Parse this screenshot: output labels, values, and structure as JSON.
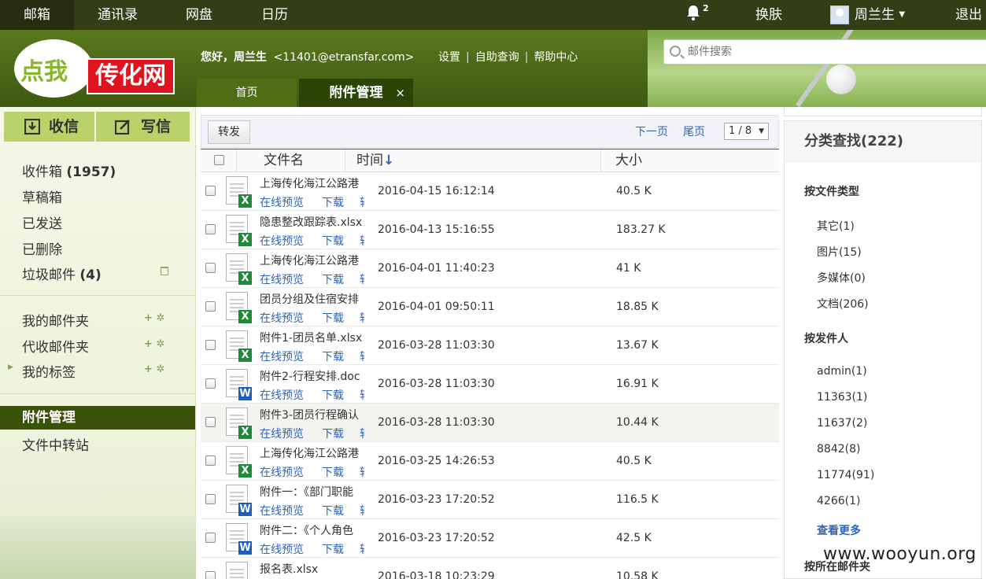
{
  "topnav": {
    "items": [
      "邮箱",
      "通讯录",
      "网盘",
      "日历"
    ],
    "notification_count": "2",
    "skin": "换肤",
    "user": "周兰生",
    "logout": "退出"
  },
  "logo": {
    "part1": "点我",
    "part2": "传化网"
  },
  "header": {
    "greeting_prefix": "您好，",
    "user_name": "周兰生",
    "email": "<11401@etransfar.com>",
    "links": [
      "设置",
      "自助查询",
      "帮助中心"
    ],
    "search_placeholder": "邮件搜索"
  },
  "tabs": {
    "home": "首页",
    "active": "附件管理",
    "close": "×"
  },
  "sidebar": {
    "inbox_button": "收信",
    "write_button": "写信",
    "folders": [
      {
        "label": "收件箱",
        "count": "(1957)"
      },
      {
        "label": "草稿箱",
        "count": ""
      },
      {
        "label": "已发送",
        "count": ""
      },
      {
        "label": "已删除",
        "count": ""
      },
      {
        "label": "垃圾邮件",
        "count": "(4)"
      }
    ],
    "groups": [
      "我的邮件夹",
      "代收邮件夹",
      "我的标签"
    ],
    "active": "附件管理",
    "transfer": "文件中转站"
  },
  "toolbar": {
    "forward": "转发",
    "next_page": "下一页",
    "last_page": "尾页",
    "page_select": "1 / 8"
  },
  "table": {
    "headers": {
      "name": "文件名",
      "time": "时间",
      "sort_arrow": "↓",
      "size": "大小"
    },
    "actions": {
      "preview": "在线预览",
      "download": "下载",
      "more": "转"
    },
    "rows": [
      {
        "name": "上海传化海江公路港",
        "type": "x",
        "time": "2016-04-15 16:12:14",
        "size": "40.5 K"
      },
      {
        "name": "隐患整改跟踪表.xlsx",
        "type": "x",
        "time": "2016-04-13 15:16:55",
        "size": "183.27 K"
      },
      {
        "name": "上海传化海江公路港",
        "type": "x",
        "time": "2016-04-01 11:40:23",
        "size": "41 K"
      },
      {
        "name": "团员分组及住宿安排",
        "type": "x",
        "time": "2016-04-01 09:50:11",
        "size": "18.85 K"
      },
      {
        "name": "附件1-团员名单.xlsx",
        "type": "x",
        "time": "2016-03-28 11:03:30",
        "size": "13.67 K"
      },
      {
        "name": "附件2-行程安排.doc",
        "type": "w",
        "time": "2016-03-28 11:03:30",
        "size": "16.91 K"
      },
      {
        "name": "附件3-团员行程确认",
        "type": "x",
        "time": "2016-03-28 11:03:30",
        "size": "10.44 K"
      },
      {
        "name": "上海传化海江公路港",
        "type": "x",
        "time": "2016-03-25 14:26:53",
        "size": "40.5 K"
      },
      {
        "name": "附件一：《部门职能",
        "type": "w",
        "time": "2016-03-23 17:20:52",
        "size": "116.5 K"
      },
      {
        "name": "附件二：《个人角色",
        "type": "w",
        "time": "2016-03-23 17:20:52",
        "size": "42.5 K"
      },
      {
        "name": "报名表.xlsx",
        "type": "x",
        "time": "2016-03-18 10:23:29",
        "size": "10.58 K"
      }
    ]
  },
  "rpanel": {
    "title": "分类查找(222)",
    "by_type": "按文件类型",
    "types": [
      "其它(1)",
      "图片(15)",
      "多媒体(0)",
      "文档(206)"
    ],
    "by_sender": "按发件人",
    "senders": [
      "admin(1)",
      "11363(1)",
      "11637(2)",
      "8842(8)",
      "11774(91)",
      "4266(1)"
    ],
    "more": "查看更多",
    "by_folder": "按所在邮件夹"
  },
  "watermark": "www.wooyun.org"
}
